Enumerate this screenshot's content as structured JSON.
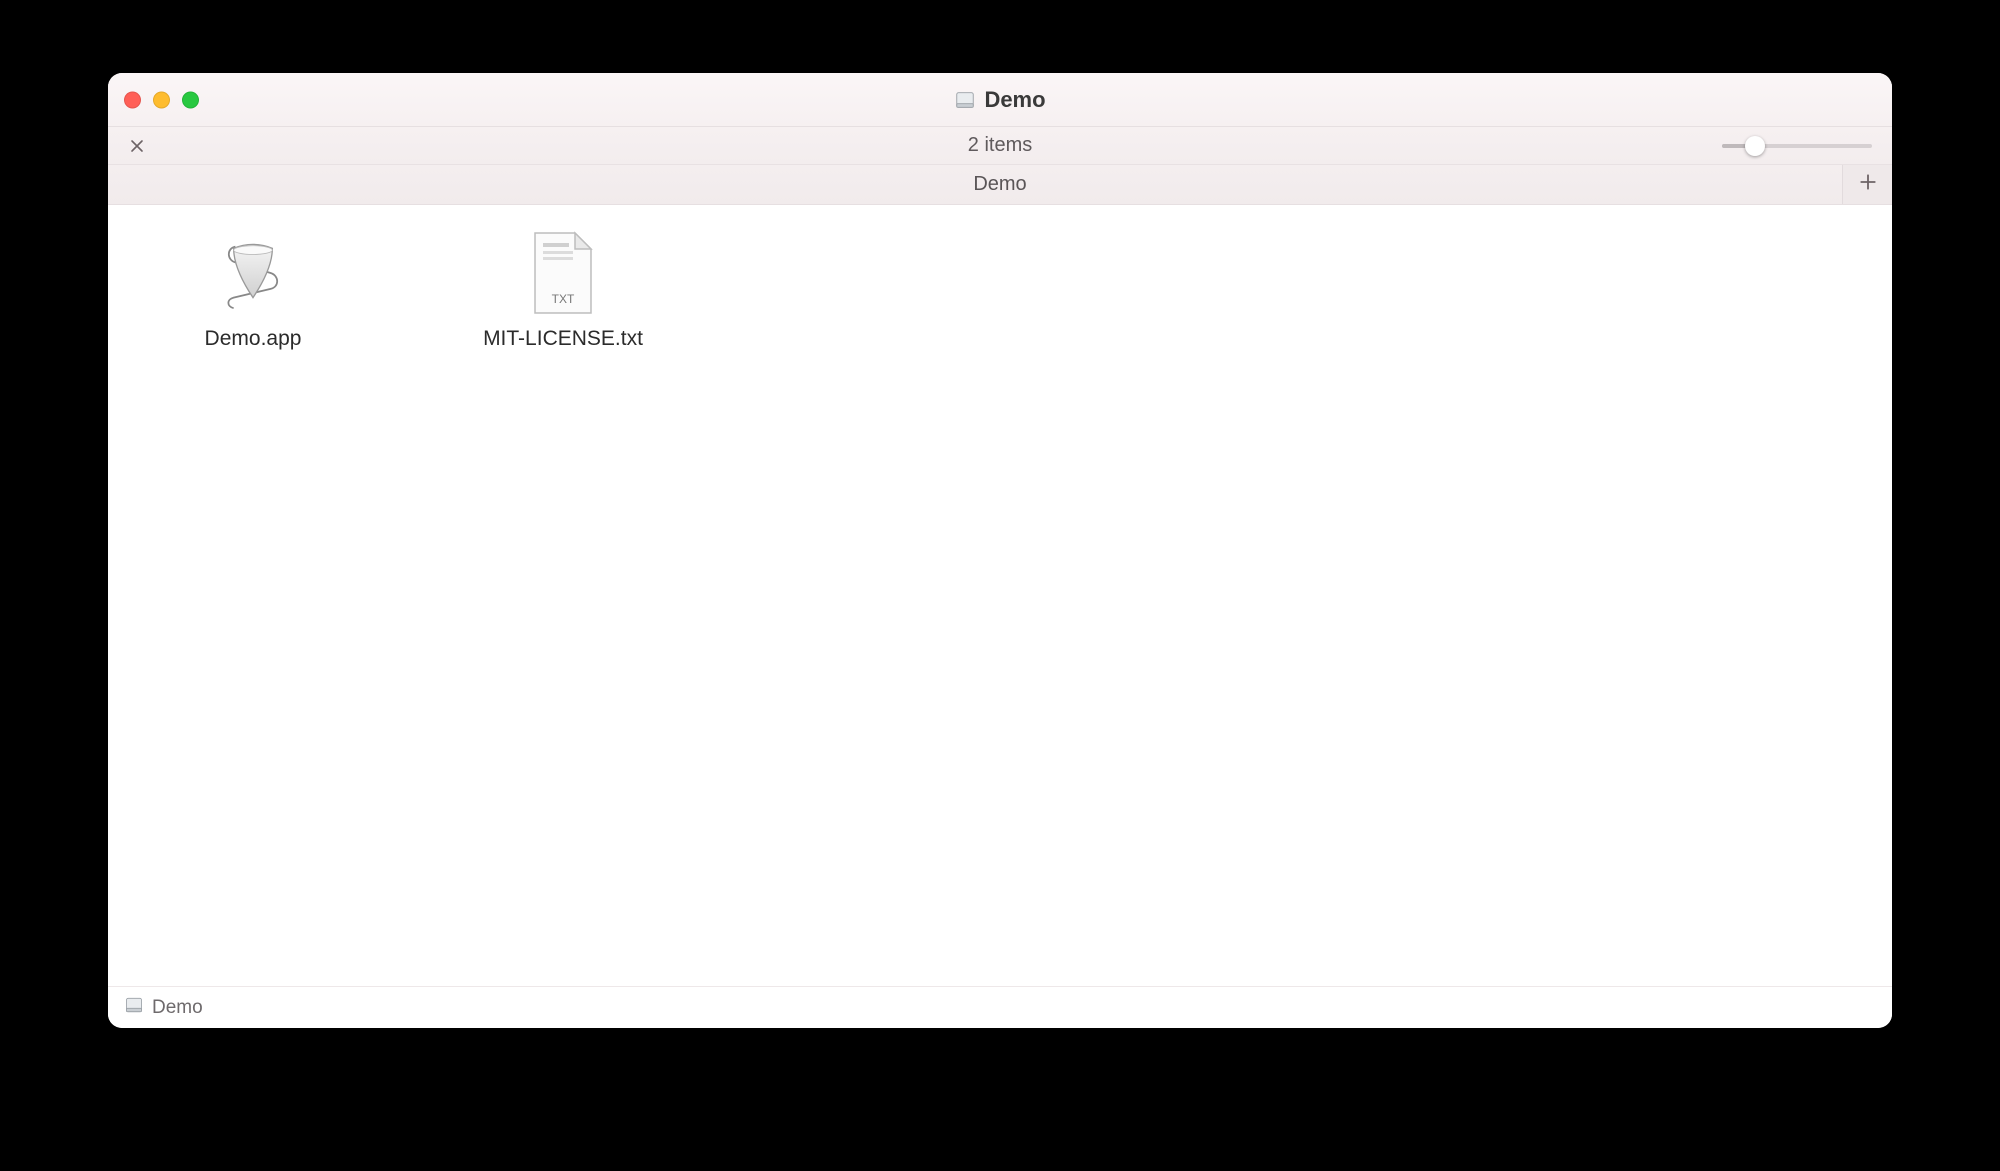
{
  "window": {
    "title": "Demo"
  },
  "toolbar": {
    "item_count": "2 items"
  },
  "tabs": {
    "active_label": "Demo"
  },
  "files": [
    {
      "name": "Demo.app",
      "kind": "script-app"
    },
    {
      "name": "MIT-LICENSE.txt",
      "kind": "txt"
    }
  ],
  "pathbar": {
    "location": "Demo"
  },
  "icons": {
    "txt_badge": "TXT"
  }
}
